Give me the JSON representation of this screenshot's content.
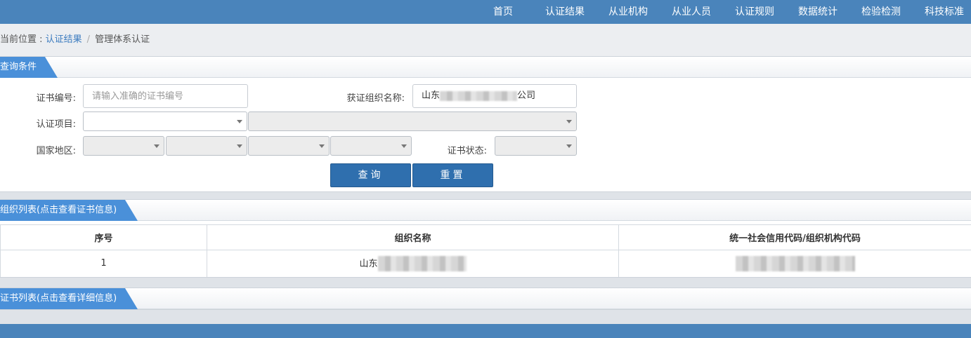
{
  "nav": {
    "items": [
      "首页",
      "认证结果",
      "从业机构",
      "从业人员",
      "认证规则",
      "数据统计",
      "检验检测",
      "科技标准"
    ]
  },
  "breadcrumb": {
    "prefix": "当前位置 : ",
    "link": "认证结果",
    "separator": "/",
    "current": "管理体系认证"
  },
  "query_panel": {
    "title": "查询条件",
    "cert_no_label": "证书编号:",
    "cert_no_placeholder": "请输入准确的证书编号",
    "org_name_label": "获证组织名称:",
    "org_name_prefix": "山东",
    "org_name_suffix": "公司",
    "project_label": "认证项目:",
    "region_label": "国家地区:",
    "status_label": "证书状态:",
    "search_button": "查询",
    "reset_button": "重置"
  },
  "org_panel": {
    "title": "组织列表(点击查看证书信息)",
    "columns": [
      "序号",
      "组织名称",
      "统一社会信用代码/组织机构代码"
    ],
    "rows": [
      {
        "index": "1",
        "name": "山东"
      }
    ]
  },
  "cert_panel": {
    "title": "证书列表(点击查看详细信息)"
  },
  "colors": {
    "nav_bg": "#4a84bb",
    "tab_blue": "#4a90d9",
    "button_blue": "#2f6fae",
    "link_blue": "#3b7bbf"
  }
}
